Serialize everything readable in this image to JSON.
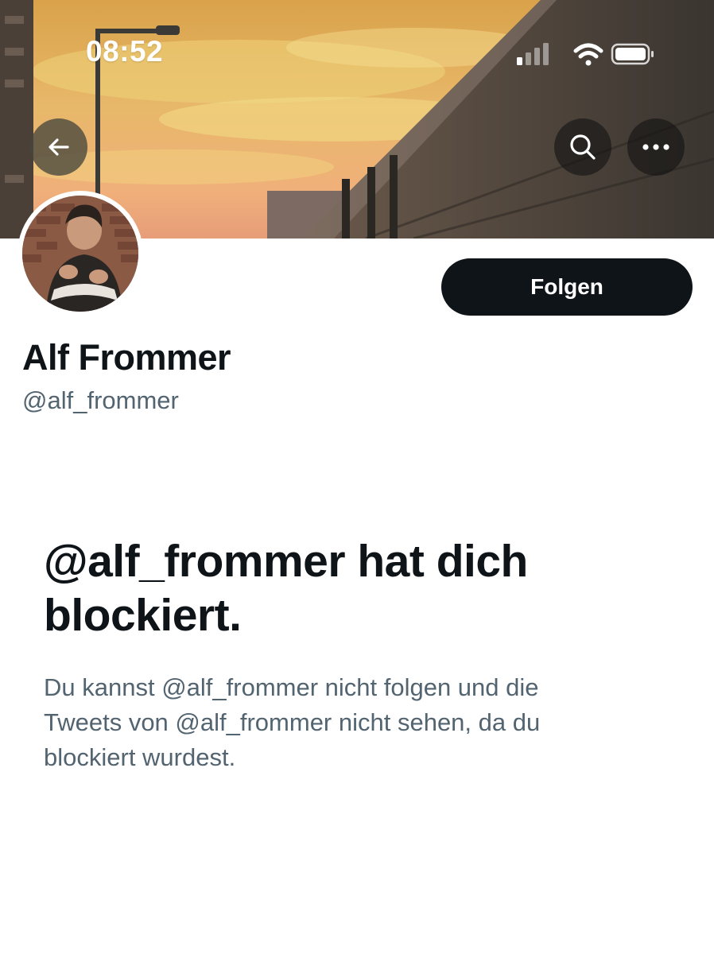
{
  "status_bar": {
    "time": "08:52",
    "signal_icon": "cellular-signal-icon",
    "wifi_icon": "wifi-icon",
    "battery_icon": "battery-icon"
  },
  "header": {
    "back_icon": "arrow-left-icon",
    "search_icon": "search-icon",
    "more_icon": "more-horizontal-icon"
  },
  "profile": {
    "display_name": "Alf Frommer",
    "handle": "@alf_frommer",
    "follow_label": "Folgen"
  },
  "blocked": {
    "title": "@alf_frommer hat dich blockiert.",
    "text": "Du kannst @alf_frommer nicht folgen und die Tweets von @alf_frommer nicht sehen, da du blockiert wurdest."
  },
  "colors": {
    "primary_text": "#0f1419",
    "secondary_text": "#536471",
    "button_bg": "#0f1419",
    "background": "#ffffff"
  }
}
